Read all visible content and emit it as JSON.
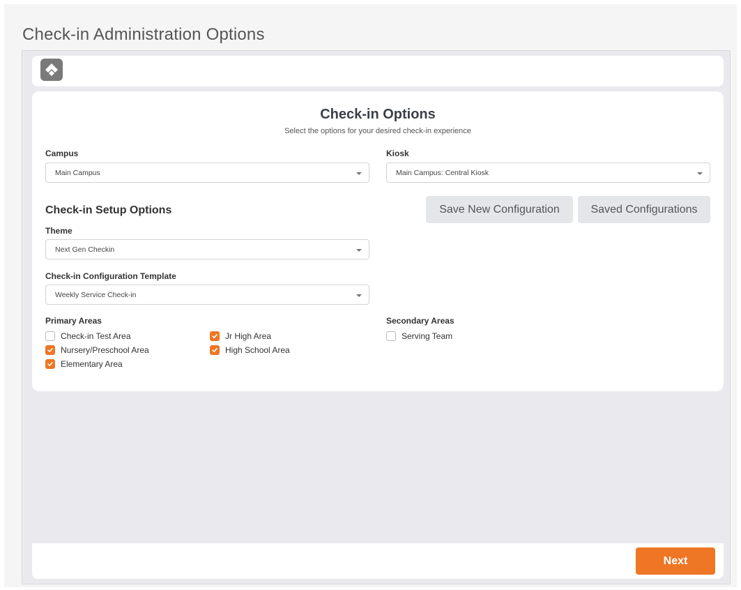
{
  "page": {
    "title": "Check-in Administration Options"
  },
  "card": {
    "title": "Check-in Options",
    "subtitle": "Select the options for your desired check-in experience"
  },
  "campus": {
    "label": "Campus",
    "value": "Main Campus"
  },
  "kiosk": {
    "label": "Kiosk",
    "value": "Main Campus: Central Kiosk"
  },
  "setup": {
    "title": "Check-in Setup Options",
    "save_new_label": "Save New Configuration",
    "saved_configs_label": "Saved Configurations"
  },
  "theme": {
    "label": "Theme",
    "value": "Next Gen Checkin"
  },
  "template": {
    "label": "Check-in Configuration Template",
    "value": "Weekly Service Check-in"
  },
  "primary_areas": {
    "label": "Primary Areas",
    "items": [
      {
        "label": "Check-in Test Area",
        "checked": false
      },
      {
        "label": "Nursery/Preschool Area",
        "checked": true
      },
      {
        "label": "Elementary Area",
        "checked": true
      },
      {
        "label": "Jr High Area",
        "checked": true
      },
      {
        "label": "High School Area",
        "checked": true
      }
    ]
  },
  "secondary_areas": {
    "label": "Secondary Areas",
    "items": [
      {
        "label": "Serving Team",
        "checked": false
      }
    ]
  },
  "footer": {
    "next_label": "Next"
  },
  "colors": {
    "accent": "#ee7624",
    "background": "#e9e9ee",
    "card": "#ffffff"
  },
  "icons": {
    "logo": "rock-logo-icon",
    "caret": "chevron-down-icon",
    "check": "check-icon"
  }
}
